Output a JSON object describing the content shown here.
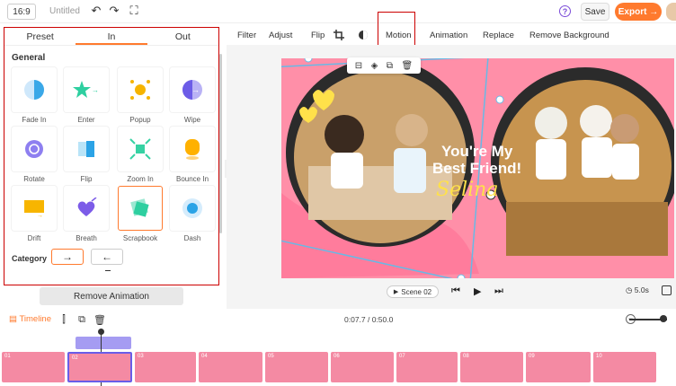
{
  "topbar": {
    "ratio": "16:9",
    "title": "Untitled",
    "save_label": "Save",
    "export_label": "Export →"
  },
  "left_panel": {
    "tabs": [
      "Preset",
      "In",
      "Out"
    ],
    "active_tab": "In",
    "section_title": "General",
    "animations": [
      {
        "label": "Fade In"
      },
      {
        "label": "Enter"
      },
      {
        "label": "Popup"
      },
      {
        "label": "Wipe"
      },
      {
        "label": "Rotate"
      },
      {
        "label": "Flip"
      },
      {
        "label": "Zoom In"
      },
      {
        "label": "Bounce In"
      },
      {
        "label": "Drift"
      },
      {
        "label": "Breath"
      },
      {
        "label": "Scrapbook"
      },
      {
        "label": "Dash"
      }
    ],
    "selected_animation": "Scrapbook",
    "category_title": "Category",
    "category_options": [
      "→",
      "←"
    ],
    "remove_label": "Remove Animation"
  },
  "toolbar": {
    "items": [
      "Filter",
      "Adjust",
      "Flip",
      "Motion",
      "Animation",
      "Replace",
      "Remove Background"
    ],
    "highlighted": "Motion"
  },
  "canvas": {
    "headline_line1": "You're My",
    "headline_line2": "Best Friend!",
    "script_text": "Selina"
  },
  "playback": {
    "scene_label": "Scene 02",
    "duration": "5.0s"
  },
  "timeline": {
    "label": "Timeline",
    "time_readout": "0:07.7 / 0:50.0",
    "clips": [
      {
        "num": "01"
      },
      {
        "num": "02"
      },
      {
        "num": "03"
      },
      {
        "num": "04"
      },
      {
        "num": "05"
      },
      {
        "num": "06"
      },
      {
        "num": "07"
      },
      {
        "num": "08"
      },
      {
        "num": "09"
      },
      {
        "num": "10"
      }
    ]
  },
  "colors": {
    "accent": "#ff7a2e",
    "highlight_border": "#cc0000",
    "canvas_pink": "#ff8fa8",
    "track_purple": "#a59cf2"
  }
}
